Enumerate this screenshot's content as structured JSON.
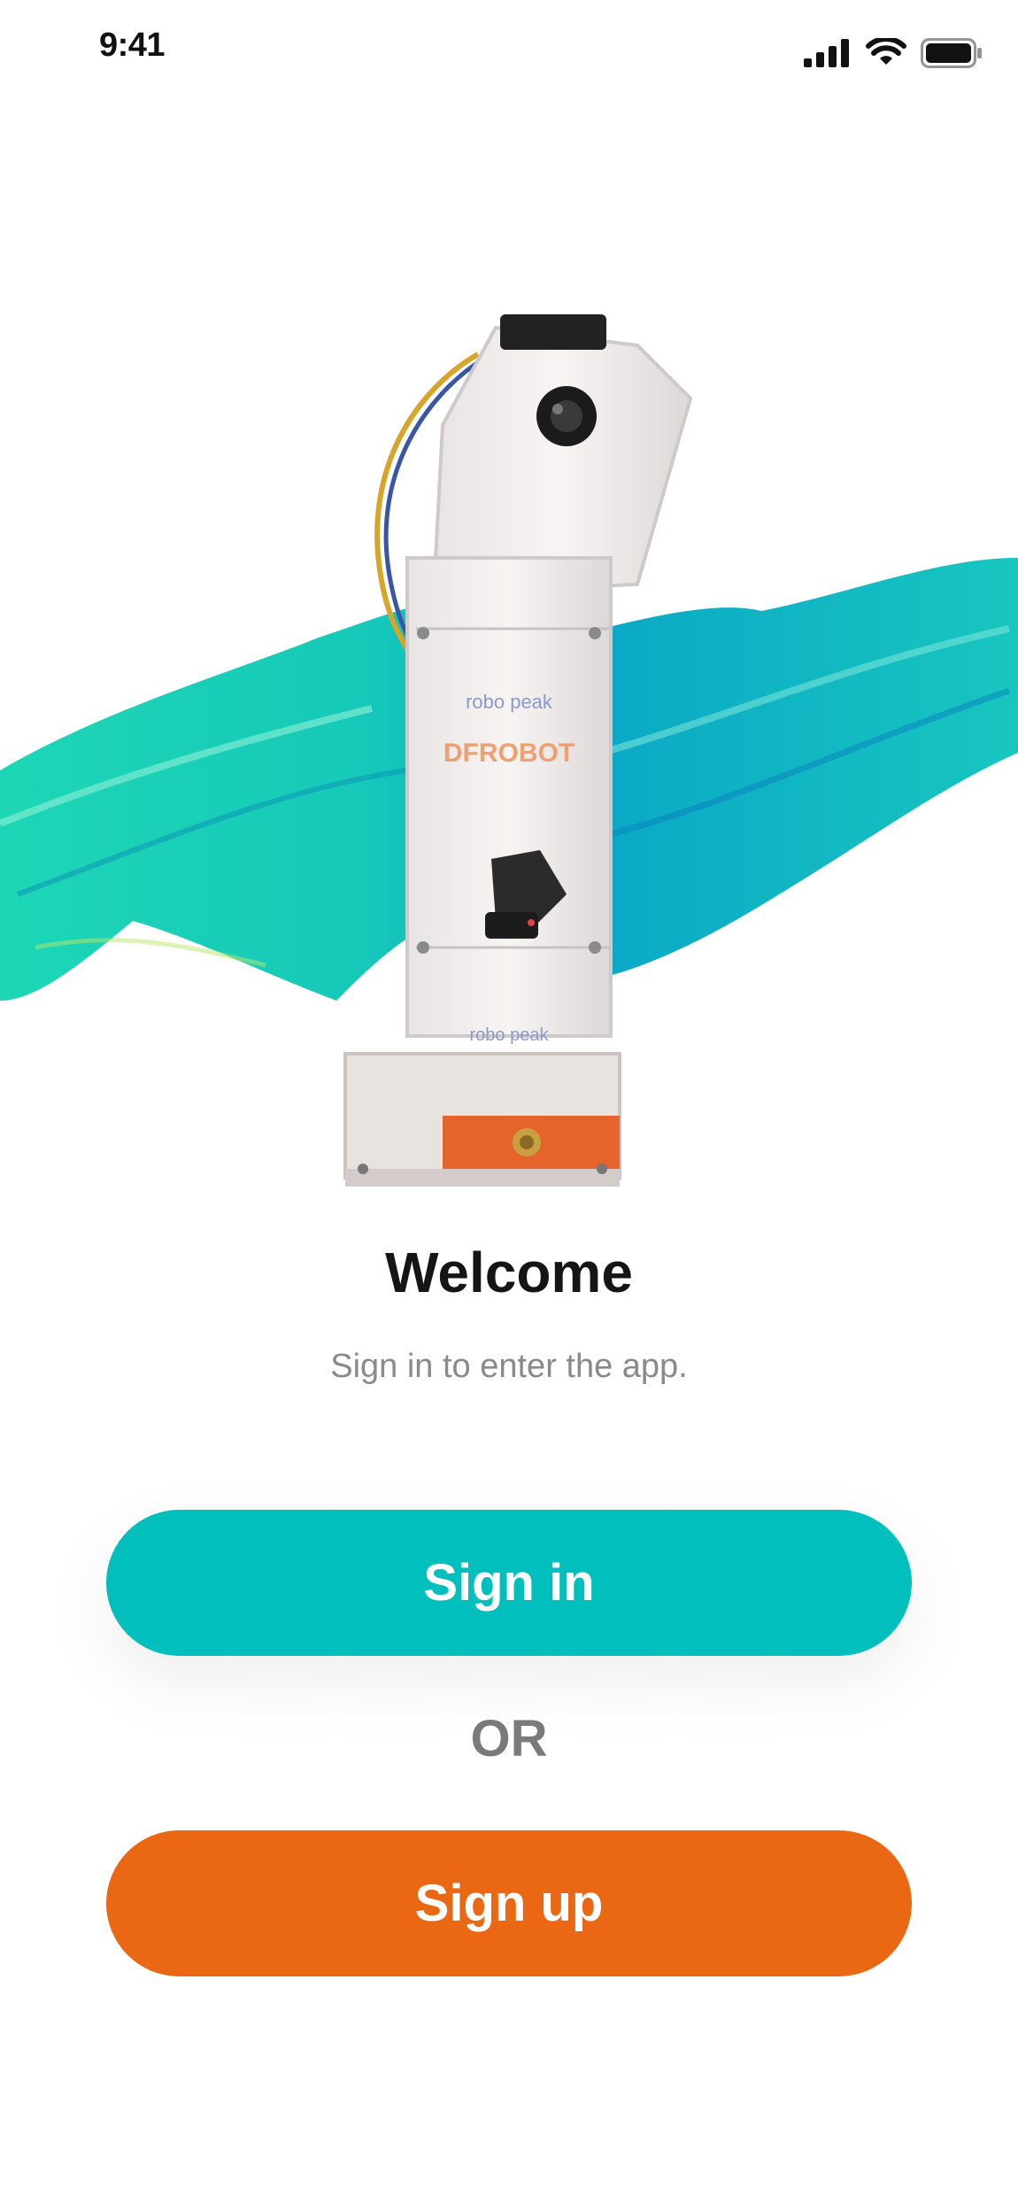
{
  "status_bar": {
    "time": "9:41",
    "icons": [
      "cellular-signal-icon",
      "wifi-icon",
      "battery-icon"
    ]
  },
  "hero": {
    "image": "robot-kit-photo",
    "background": "teal-paint-stroke",
    "brand_marks": [
      "robo peak",
      "DFROBOT"
    ]
  },
  "content": {
    "title": "Welcome",
    "subtitle": "Sign in to enter the app."
  },
  "actions": {
    "signin_label": "Sign in",
    "or_label": "OR",
    "signup_label": "Sign up"
  },
  "colors": {
    "primary": "#00bfbd",
    "secondary": "#ea6813",
    "text": "#151515",
    "muted": "#8a8a8a"
  }
}
